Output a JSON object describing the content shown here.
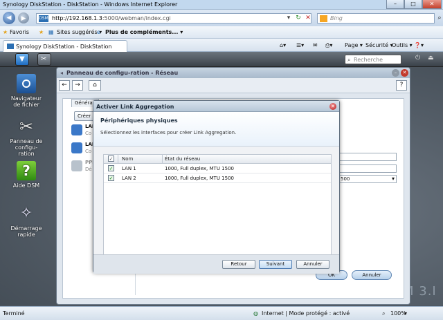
{
  "browser": {
    "title": "Synology DiskStation - DiskStation - Windows Internet Explorer",
    "url_host": "http://192.168.1.3",
    "url_path": ":5000/webman/index.cgi",
    "search_placeholder": "Bing",
    "favorites_label": "Favoris",
    "suggested_sites": "Sites suggérés ▾",
    "more_addons": "Plus de compléments... ▾",
    "tab_title": "Synology DiskStation - DiskStation",
    "tools": {
      "page": "Page ▾",
      "security": "Sécurité ▾",
      "tools": "Outils ▾",
      "help": "❓▾"
    },
    "status_left": "Terminé",
    "status_zone": "Internet | Mode protégé : activé",
    "zoom": "100%"
  },
  "dsm": {
    "search_placeholder": "Recherche",
    "watermark": "M 3.I",
    "desktop_icons": [
      {
        "label": "Navigateur de fichier"
      },
      {
        "label": "Panneau de configu- ration"
      },
      {
        "label": "Aide DSM"
      },
      {
        "label": "Démarrage rapide"
      }
    ]
  },
  "control_panel": {
    "title": "Panneau de configu-ration - Réseau",
    "tab_label": "Généra",
    "create_button": "Créer",
    "list": [
      {
        "name": "LAN",
        "sub": "Co"
      },
      {
        "name": "LAN",
        "sub": "Co"
      },
      {
        "name": "PPP",
        "sub": "Dé"
      }
    ],
    "select_value": "500",
    "ok_button": "OK",
    "cancel_button": "Annuler"
  },
  "modal": {
    "title": "Activer Link Aggregation",
    "heading": "Périphériques physiques",
    "description": "Sélectionnez les interfaces pour créer Link Aggregation.",
    "columns": {
      "name": "Nom",
      "status": "État du réseau"
    },
    "rows": [
      {
        "name": "LAN 1",
        "status": "1000, Full duplex, MTU 1500",
        "checked": true
      },
      {
        "name": "LAN 2",
        "status": "1000, Full duplex, MTU 1500",
        "checked": true
      }
    ],
    "back_button": "Retour",
    "next_button": "Suivant",
    "cancel_button": "Annuler"
  }
}
